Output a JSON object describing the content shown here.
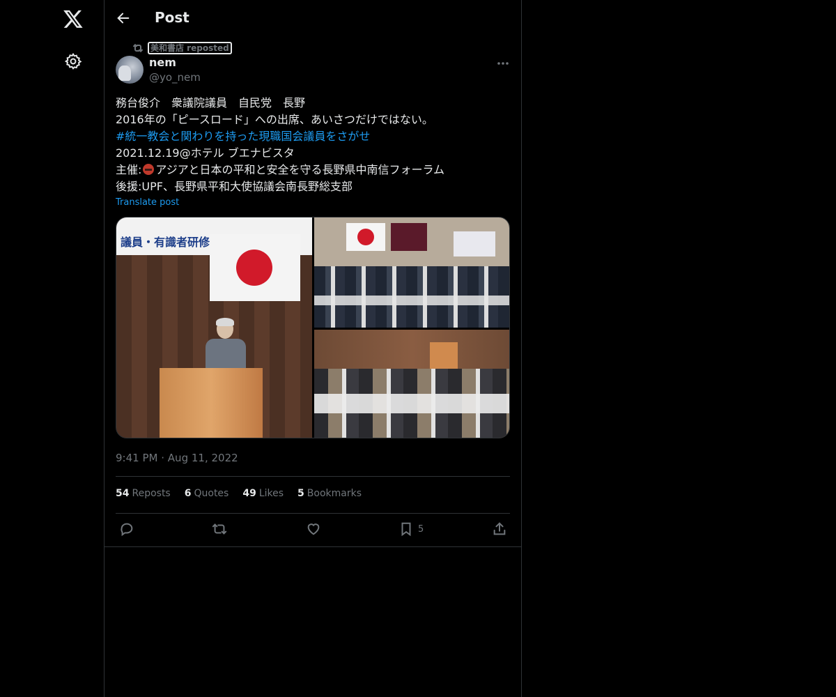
{
  "header": {
    "title": "Post"
  },
  "repost": {
    "text": "美和書店 reposted"
  },
  "author": {
    "name": "nem",
    "handle": "@yo_nem"
  },
  "post": {
    "line1": "務台俊介　衆議院議員　自民党　長野",
    "line2": "2016年の「ピースロード」への出席、あいさつだけではない。",
    "hashtag": "#統一教会と関わりを持った現職国会議員をさがせ",
    "line4": "2021.12.19@ホテル ブエナビスタ",
    "line5_prefix": "主催:",
    "line5_rest": "アジアと日本の平和と安全を守る長野県中南信フォーラム",
    "line6": "後援:UPF、長野県平和大使協議会南長野総支部",
    "translate": "Translate post"
  },
  "media": {
    "photo1_banner": "議員・有識者研修「我が国の安"
  },
  "timestamp": {
    "time": "9:41 PM",
    "sep": "·",
    "date": "Aug 11, 2022"
  },
  "stats": {
    "reposts": {
      "num": "54",
      "label": "Reposts"
    },
    "quotes": {
      "num": "6",
      "label": "Quotes"
    },
    "likes": {
      "num": "49",
      "label": "Likes"
    },
    "bookmarks": {
      "num": "5",
      "label": "Bookmarks"
    }
  },
  "actions": {
    "bookmark_count": "5"
  },
  "icons": {
    "logo": "x-logo-icon",
    "settings": "gear-icon",
    "back": "arrow-left-icon",
    "more": "more-horizontal-icon",
    "reply": "reply-icon",
    "repost": "repost-icon",
    "like": "heart-icon",
    "bookmark": "bookmark-icon",
    "share": "share-icon"
  },
  "colors": {
    "background": "#000000",
    "text": "#e7e9ea",
    "muted": "#71767b",
    "accent": "#1d9bf0",
    "border": "#2f3336"
  }
}
